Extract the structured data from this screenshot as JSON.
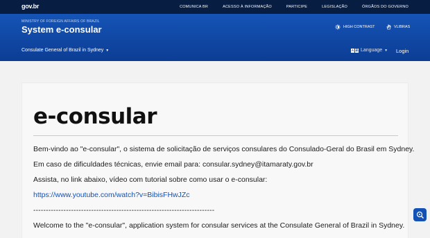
{
  "gov_bar": {
    "logo": "gov.br",
    "links": [
      "COMUNICA BR",
      "ACESSO À INFORMAÇÃO",
      "PARTICIPE",
      "LEGISLAÇÃO",
      "ÓRGÃOS DO GOVERNO"
    ]
  },
  "header": {
    "ministry": "MINISTRY OF FOREIGN AFFAIRS OF BRAZIL",
    "title": "System e-consular",
    "high_contrast": "HIGH CONTRAST",
    "vlibras": "VLIBRAS",
    "consulate_menu": "Consulate General of Brazil in Sydney",
    "language_menu": "Language",
    "login": "Login"
  },
  "content": {
    "title": "e-consular",
    "paragraphs": [
      "Bem-vindo ao \"e-consular\", o sistema de solicitação de serviços consulares do Consulado-Geral do Brasil em Sydney.",
      "Em caso de dificuldades técnicas, envie email para: consular.sydney@itamaraty.gov.br",
      "Assista, no link abaixo, vídeo com tutorial sobre como usar o e-consular:",
      "https://www.youtube.com/watch?v=BibisFHwJZc",
      "------------------------------------------------------------------------",
      "Welcome to the \"e-consular\", application system for consular services at the Consulate General of Brazil in Sydney."
    ]
  },
  "colors": {
    "gov_bar": "#071d41",
    "header": "#1351b4",
    "link": "#1351b4"
  },
  "icons": {
    "high_contrast": "contrast-icon",
    "vlibras": "hand-icon",
    "accessibility": "accessibility-icon"
  }
}
